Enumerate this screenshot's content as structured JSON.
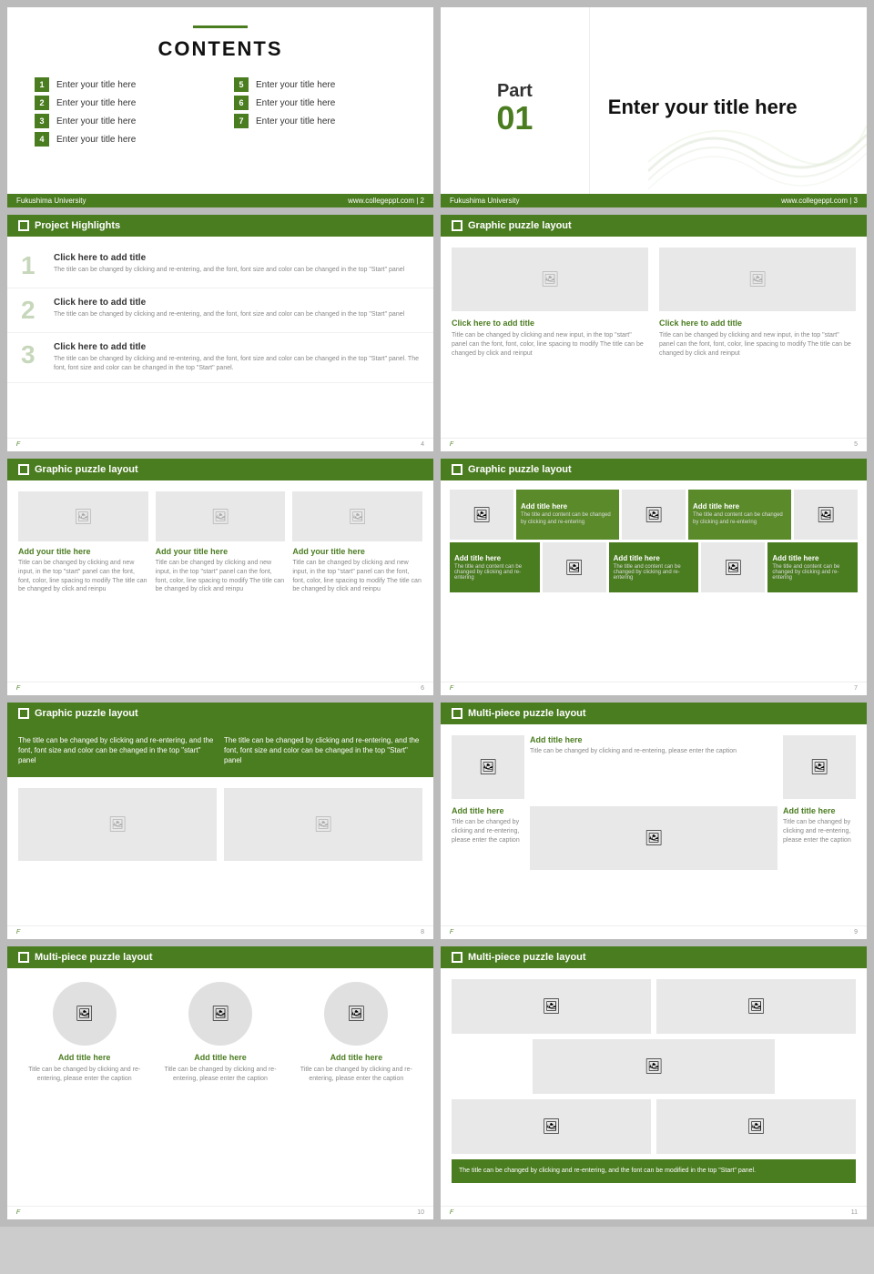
{
  "slides": {
    "contents": {
      "title": "CONTENTS",
      "items": [
        {
          "num": "1",
          "text": "Enter your title here"
        },
        {
          "num": "2",
          "text": "Enter your title here"
        },
        {
          "num": "3",
          "text": "Enter your title here"
        },
        {
          "num": "4",
          "text": "Enter your title here"
        },
        {
          "num": "5",
          "text": "Enter your title here"
        },
        {
          "num": "6",
          "text": "Enter your title here"
        },
        {
          "num": "7",
          "text": "Enter your title here"
        }
      ],
      "footer_left": "Fukushima University",
      "footer_right": "www.collegeppt.com | 2"
    },
    "part": {
      "label": "Part",
      "number": "01",
      "title": "Enter your title here",
      "footer_left": "Fukushima University",
      "footer_right": "www.collegeppt.com | 3"
    },
    "highlights": {
      "section": "Project Highlights",
      "items": [
        {
          "num": "1",
          "title": "Click here to add title",
          "desc": "The title can be changed by clicking and re-entering, and the font, font size and color can be changed in the top \"Start\" panel"
        },
        {
          "num": "2",
          "title": "Click here to add title",
          "desc": "The title can be changed by clicking and re-entering, and the font, font size and color can be changed in the top \"Start\" panel"
        },
        {
          "num": "3",
          "title": "Click here to add title",
          "desc": "The title can be changed by clicking and re-entering, and the font, font size and color can be changed in the top \"Start\" panel. The font, font size and color can be changed in the top \"Start\" panel."
        }
      ],
      "footer_page": "4"
    },
    "puzzle2": {
      "section": "Graphic puzzle layout",
      "items": [
        {
          "title": "Click here to add title",
          "desc": "Title can be changed by clicking and new input, in the top \"start\" panel can the font, font, color, line spacing to modify The title can be changed by click and reinput"
        },
        {
          "title": "Click here to add title",
          "desc": "Title can be changed by clicking and new input, in the top \"start\" panel can the font, font, color, line spacing to modify The title can be changed by click and reinput"
        }
      ],
      "footer_page": "5"
    },
    "puzzle3": {
      "section": "Graphic puzzle layout",
      "items": [
        {
          "title": "Add your title here",
          "desc": "Title can be changed by clicking and new input, in the top \"start\" panel can the font, font, color, line spacing to modify The title can be changed by click and reinpu"
        },
        {
          "title": "Add your title here",
          "desc": "Title can be changed by clicking and new input, in the top \"start\" panel can the font, font, color, line spacing to modify The title can be changed by click and reinpu"
        },
        {
          "title": "Add your title here",
          "desc": "Title can be changed by clicking and new input, in the top \"start\" panel can the font, font, color, line spacing to modify The title can be changed by click and reinpu"
        }
      ],
      "footer_page": "6"
    },
    "puzzle_tiles": {
      "section": "Graphic puzzle layout",
      "row1": [
        {
          "type": "img"
        },
        {
          "type": "text",
          "title": "Add title here",
          "desc": "The title and content can be changed by clicking and re-entering"
        },
        {
          "type": "img"
        },
        {
          "type": "text",
          "title": "Add title here",
          "desc": "The title and content can be changed by clicking and re-entering"
        },
        {
          "type": "img"
        }
      ],
      "row2": [
        {
          "type": "text",
          "title": "Add title here",
          "desc": "The title and content can be changed by clicking and re-entering"
        },
        {
          "type": "img"
        },
        {
          "type": "text",
          "title": "Add title here",
          "desc": "The title and content can be changed by clicking and re-entering"
        },
        {
          "type": "img"
        },
        {
          "type": "text",
          "title": "Add title here",
          "desc": "The title and content can be changed by clicking and re-entering"
        }
      ],
      "footer_page": "7"
    },
    "puzzle_green": {
      "section": "Graphic puzzle layout",
      "top_texts": [
        "The title can be changed by clicking and re-entering, and the font, font size and color can be changed in the top \"start\" panel",
        "The title can be changed by clicking and re-entering, and the font, font size and color can be changed in the top \"Start\" panel"
      ],
      "footer_page": "8"
    },
    "multi1": {
      "section": "Multi-piece puzzle layout",
      "rows": [
        {
          "title": "Add title here",
          "desc": "Title can be changed by clicking and re-entering, please enter the caption"
        },
        {
          "title": "Add title here",
          "desc": "Title can be changed by clicking and re-entering, please enter the caption"
        }
      ],
      "footer_page": "9"
    },
    "circles": {
      "section": "Multi-piece puzzle layout",
      "items": [
        {
          "title": "Add title here",
          "desc": "Title can be changed by clicking and re-entering, please enter the caption"
        },
        {
          "title": "Add title here",
          "desc": "Title can be changed by clicking and re-entering, please enter the caption"
        },
        {
          "title": "Add title here",
          "desc": "Title can be changed by clicking and re-entering, please enter the caption"
        }
      ],
      "footer_page": "10"
    },
    "scattered": {
      "section": "Multi-piece puzzle layout",
      "caption": "The title can be changed by clicking and re-entering, and the font can be modified in the top \"Start\" panel.",
      "footer_page": "11"
    }
  },
  "colors": {
    "green": "#4a7c20",
    "light_green": "#5a8a2a",
    "text_dark": "#222",
    "text_gray": "#888",
    "bg_gray": "#e8e8e8"
  },
  "icons": {
    "image": "🖼",
    "checkbox": "□"
  }
}
